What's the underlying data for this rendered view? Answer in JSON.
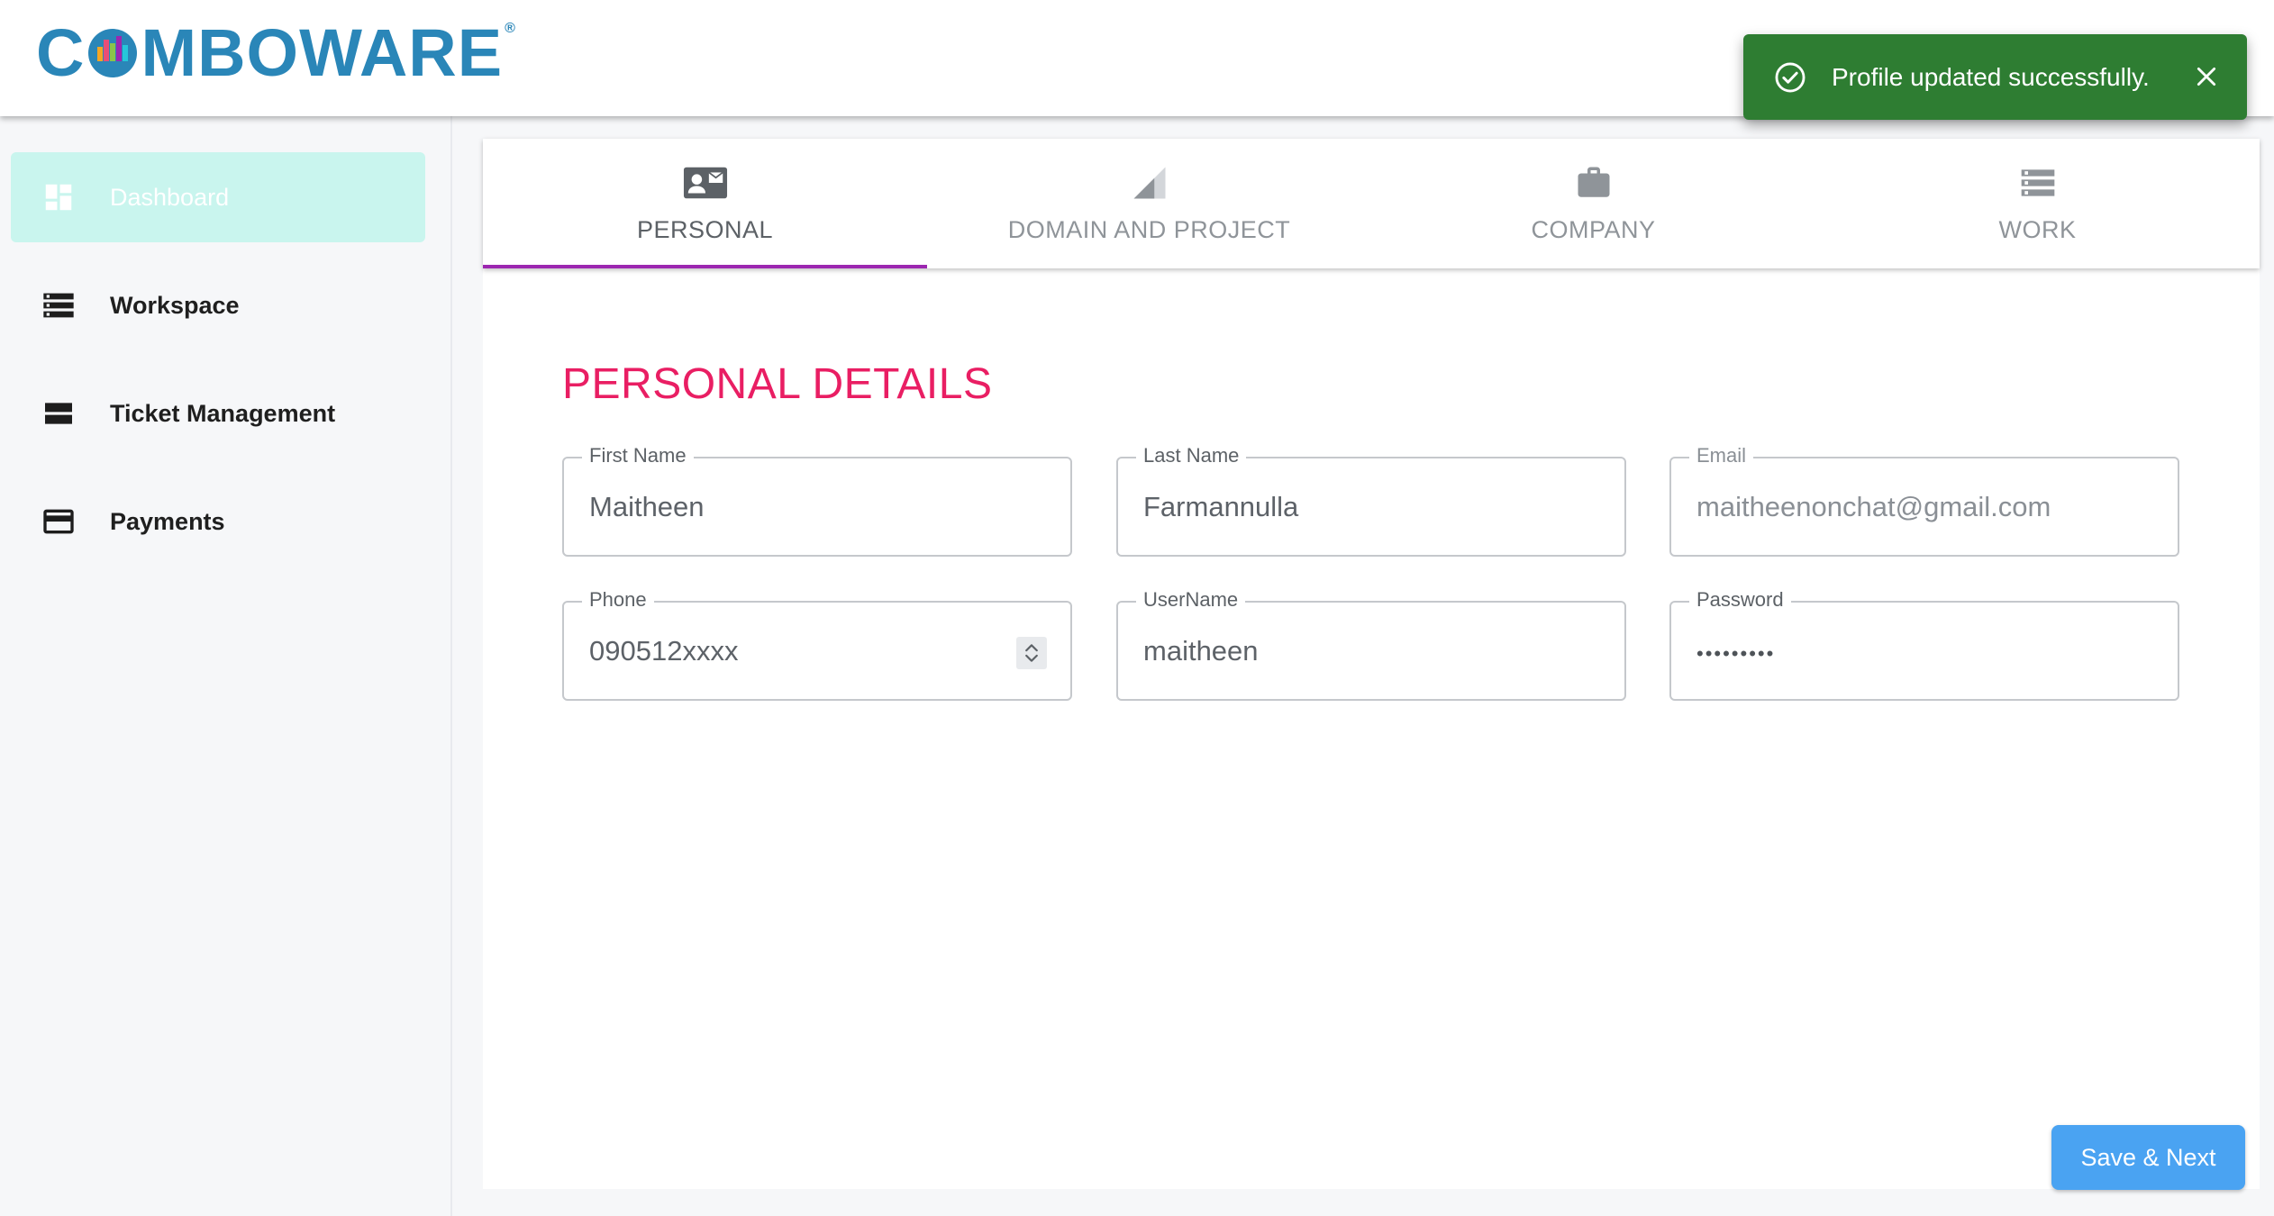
{
  "app": {
    "logo_text_start": "C",
    "logo_text_end": "MBOWARE",
    "logo_registered": "®",
    "brand_color": "#2a86b8"
  },
  "sidebar": {
    "items": [
      {
        "label": "Dashboard",
        "icon": "dashboard-icon",
        "active": true
      },
      {
        "label": "Workspace",
        "icon": "storage-icon",
        "active": false
      },
      {
        "label": "Ticket Management",
        "icon": "view-list-icon",
        "active": false
      },
      {
        "label": "Payments",
        "icon": "credit-card-icon",
        "active": false
      }
    ]
  },
  "tabs": [
    {
      "label": "PERSONAL",
      "icon": "contact-mail-icon",
      "active": true
    },
    {
      "label": "DOMAIN AND PROJECT",
      "icon": "signal-cellular-icon",
      "active": false
    },
    {
      "label": "COMPANY",
      "icon": "briefcase-icon",
      "active": false
    },
    {
      "label": "WORK",
      "icon": "storage-icon",
      "active": false
    }
  ],
  "form": {
    "section_title": "PERSONAL DETAILS",
    "first_name": {
      "label": "First Name",
      "value": "Maitheen"
    },
    "last_name": {
      "label": "Last Name",
      "value": "Farmannulla"
    },
    "email": {
      "label": "Email",
      "value": "maitheenonchat@gmail.com"
    },
    "phone": {
      "label": "Phone",
      "value": "090512xxxx"
    },
    "username": {
      "label": "UserName",
      "value": "maitheen"
    },
    "password": {
      "label": "Password",
      "value": "•••••••••"
    }
  },
  "actions": {
    "save_next_label": "Save & Next"
  },
  "toast": {
    "message": "Profile updated successfully.",
    "status": "success",
    "color": "#2e7d32"
  },
  "colors": {
    "accent_title": "#e91e63",
    "tab_indicator": "#9c27b0",
    "active_nav_bg": "#c9f5ee",
    "button": "#4aa3f2"
  }
}
